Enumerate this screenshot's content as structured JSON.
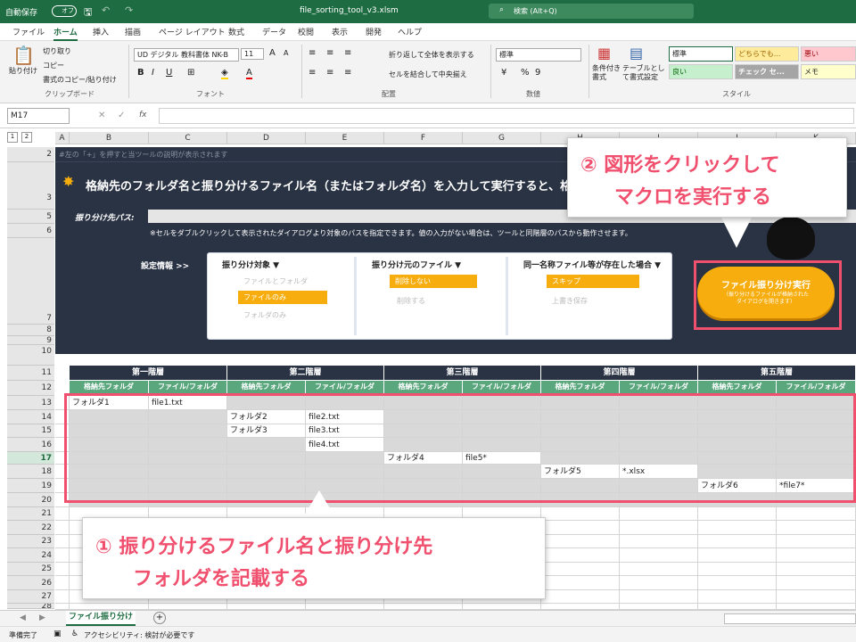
{
  "titlebar": {
    "autosave": "自動保存",
    "toggle": "オフ",
    "filename": "file_sorting_tool_v3.xlsm",
    "search": "検索 (Alt+Q)"
  },
  "menu": {
    "tabs": [
      "ファイル",
      "ホーム",
      "挿入",
      "描画",
      "ページ レイアウト",
      "数式",
      "データ",
      "校閲",
      "表示",
      "開発",
      "ヘルプ"
    ]
  },
  "ribbon": {
    "clipboard": {
      "paste": "貼り付け",
      "cut": "切り取り",
      "copy": "コピー",
      "format_painter": "書式のコピー/貼り付け",
      "label": "クリップボード"
    },
    "font": {
      "name": "UD デジタル 教科書体 NK-B",
      "size": "11",
      "label": "フォント",
      "bold": "B",
      "italic": "I",
      "underline": "U",
      "grow": "A",
      "shrink": "A"
    },
    "align": {
      "wrap": "折り返して全体を表示する",
      "merge": "セルを結合して中央揃え",
      "label": "配置"
    },
    "number": {
      "format": "標準",
      "label": "数値",
      "pct": "%",
      "comma": "9"
    },
    "styles": {
      "cond": "条件付き書式",
      "table": "テーブルとして書式設定",
      "label": "スタイル",
      "cells": [
        "標準",
        "どちらでも...",
        "悪い",
        "良い",
        "チェック セ...",
        "メモ"
      ]
    }
  },
  "formula": {
    "namebox": "M17",
    "fx": "fx"
  },
  "columns": [
    "A",
    "B",
    "C",
    "D",
    "E",
    "F",
    "G",
    "H",
    "I",
    "J",
    "K"
  ],
  "rows": [
    "2",
    "3",
    "5",
    "6",
    "7",
    "8",
    "9",
    "10",
    "11",
    "12",
    "13",
    "14",
    "15",
    "16",
    "17",
    "18",
    "19",
    "20",
    "21",
    "22",
    "23",
    "24",
    "25",
    "26",
    "27",
    "28"
  ],
  "sheet": {
    "row2": "#左の「+」を押すと当ツールの説明が表示されます",
    "heading": "格納先のフォルダ名と振り分けるファイル名（またはフォルダ名）を入力して実行すると、格",
    "path_label": "振り分け先パス:",
    "note": "※セルをダブルクリックして表示されたダイアログより対象のパスを指定できます。値の入力がない場合は、ツールと同階層のパスから動作させます。",
    "settings_label": "設定情報 >>",
    "panels": [
      {
        "title": "振り分け対象 ▼",
        "options": [
          "ファイルとフォルダ",
          "ファイルのみ",
          "フォルダのみ"
        ],
        "selected": 1
      },
      {
        "title": "振り分け元のファイル ▼",
        "options": [
          "削除しない",
          "削除する"
        ],
        "selected": 0
      },
      {
        "title": "同一名称ファイル等が存在した場合 ▼",
        "options": [
          "スキップ",
          "上書き保存"
        ],
        "selected": 0
      }
    ],
    "exec_button": {
      "title": "ファイル振り分け実行",
      "sub": "（振り分けるファイルが格納された\nダイアログを開きます）"
    },
    "levels": [
      "第一階層",
      "第二階層",
      "第三階層",
      "第四階層",
      "第五階層"
    ],
    "subheaders": [
      "格納先フォルダ",
      "ファイル/フォルダ"
    ],
    "data": [
      [
        "フォルダ1",
        "file1.txt",
        "",
        "",
        "",
        "",
        "",
        "",
        "",
        ""
      ],
      [
        "",
        "",
        "フォルダ2",
        "file2.txt",
        "",
        "",
        "",
        "",
        "",
        ""
      ],
      [
        "",
        "",
        "フォルダ3",
        "file3.txt",
        "",
        "",
        "",
        "",
        "",
        ""
      ],
      [
        "",
        "",
        "",
        "file4.txt",
        "",
        "",
        "",
        "",
        "",
        ""
      ],
      [
        "",
        "",
        "",
        "",
        "フォルダ4",
        "file5*",
        "",
        "",
        "",
        ""
      ],
      [
        "",
        "",
        "",
        "",
        "",
        "",
        "フォルダ5",
        "*.xlsx",
        "",
        ""
      ],
      [
        "",
        "",
        "",
        "",
        "",
        "",
        "",
        "",
        "フォルダ6",
        "*file7*"
      ]
    ]
  },
  "callouts": {
    "c1_line1": "① 振り分けるファイル名と振り分け先",
    "c1_line2": "フォルダを記載する",
    "c2_line1": "② 図形をクリックして",
    "c2_line2": "マクロを実行する"
  },
  "sheettab": {
    "name": "ファイル振り分け",
    "add": "+"
  },
  "status": {
    "ready": "準備完了",
    "access": "アクセシビリティ: 検討が必要です"
  },
  "colors": {
    "accent": "#1e6c41",
    "callout": "#f0506e",
    "button": "#f6ad0d",
    "dark": "#2a3344"
  }
}
